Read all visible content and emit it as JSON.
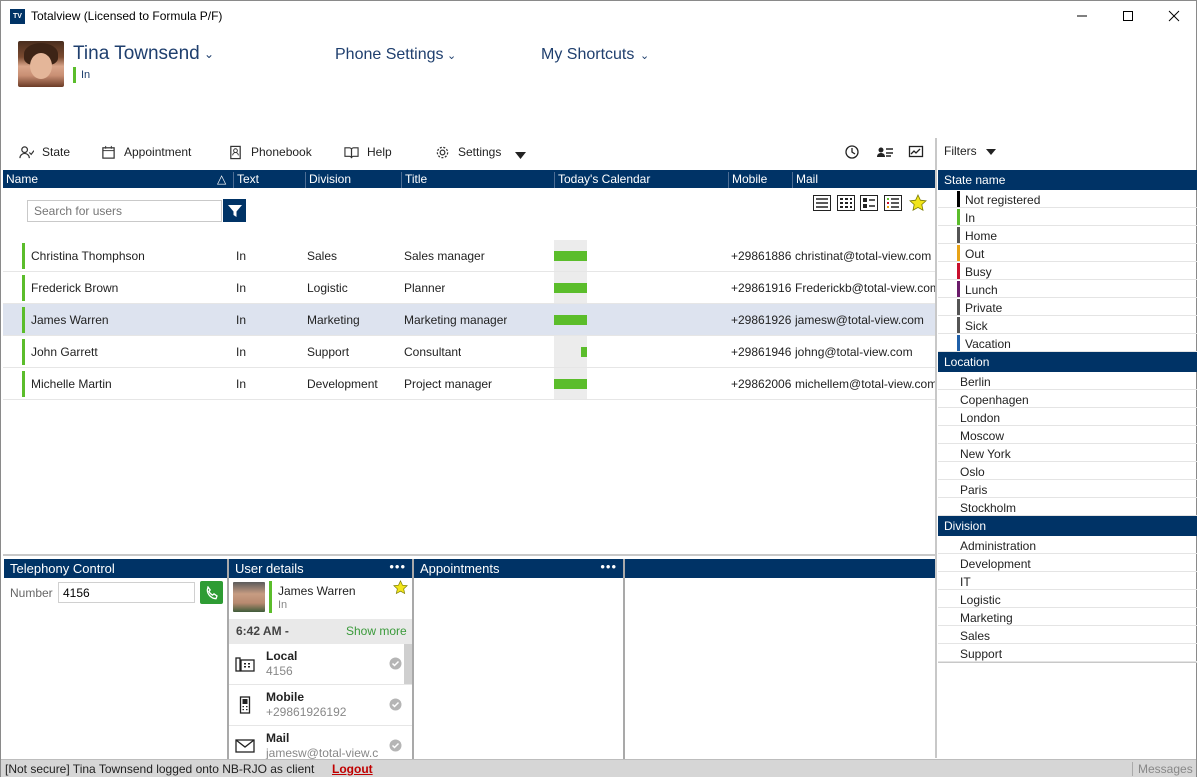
{
  "window": {
    "logo_text": "TV",
    "title": "Totalview  (Licensed to Formula P/F)"
  },
  "user": {
    "name": "Tina Townsend",
    "state": "In",
    "state_color": "#5bbd2b"
  },
  "top_menus": {
    "phone_settings": "Phone Settings",
    "my_shortcuts": "My Shortcuts"
  },
  "toolbar": {
    "state": "State",
    "appointment": "Appointment",
    "phonebook": "Phonebook",
    "help": "Help",
    "settings": "Settings"
  },
  "grid": {
    "columns": [
      "Name",
      "Text",
      "Division",
      "Title",
      "Today's Calendar",
      "Mobile",
      "Mail"
    ],
    "search_placeholder": "Search for users",
    "rows": [
      {
        "name": "Christina Thomphson",
        "text": "In",
        "division": "Sales",
        "title": "Sales manager",
        "calendar_fill": 1.0,
        "mobile": "+29861886",
        "mail": "christinat@total-view.com"
      },
      {
        "name": "Frederick Brown",
        "text": "In",
        "division": "Logistic",
        "title": "Planner",
        "calendar_fill": 1.0,
        "mobile": "+29861916",
        "mail": "Frederickb@total-view.com"
      },
      {
        "name": "James Warren",
        "text": "In",
        "division": "Marketing",
        "title": "Marketing manager",
        "calendar_fill": 1.0,
        "mobile": "+29861926",
        "mail": "jamesw@total-view.com"
      },
      {
        "name": "John Garrett",
        "text": "In",
        "division": "Support",
        "title": "Consultant",
        "calendar_fill": 0.18,
        "mobile": "+29861946",
        "mail": "johng@total-view.com"
      },
      {
        "name": "Michelle Martin",
        "text": "In",
        "division": "Development",
        "title": "Project manager",
        "calendar_fill": 1.0,
        "mobile": "+29862006",
        "mail": "michellem@total-view.com"
      }
    ]
  },
  "telephony": {
    "header": "Telephony Control",
    "number_label": "Number",
    "number_value": "4156"
  },
  "user_details": {
    "header": "User details",
    "name": "James Warren",
    "state": "In",
    "time": "6:42 AM -",
    "show_more": "Show more",
    "contacts": [
      {
        "label": "Local",
        "value": "4156"
      },
      {
        "label": "Mobile",
        "value": "+29861926192"
      },
      {
        "label": "Mail",
        "value": "jamesw@total-view.c"
      }
    ]
  },
  "appointments": {
    "header": "Appointments"
  },
  "filters": {
    "label": "Filters",
    "state_header": "State name",
    "states": [
      {
        "name": "Not registered",
        "color": "#000000"
      },
      {
        "name": "In",
        "color": "#5bbd2b"
      },
      {
        "name": "Home",
        "color": "#555555"
      },
      {
        "name": "Out",
        "color": "#e8a317"
      },
      {
        "name": "Busy",
        "color": "#c8102e"
      },
      {
        "name": "Lunch",
        "color": "#6a1b6a"
      },
      {
        "name": "Private",
        "color": "#555555"
      },
      {
        "name": "Sick",
        "color": "#555555"
      },
      {
        "name": "Vacation",
        "color": "#1f5fa8"
      }
    ],
    "location_header": "Location",
    "locations": [
      "Berlin",
      "Copenhagen",
      "London",
      "Moscow",
      "New York",
      "Oslo",
      "Paris",
      "Stockholm"
    ],
    "division_header": "Division",
    "divisions": [
      "Administration",
      "Development",
      "IT",
      "Logistic",
      "Marketing",
      "Sales",
      "Support"
    ]
  },
  "status": {
    "text": "[Not secure] Tina Townsend logged onto NB-RJO as client",
    "logout": "Logout",
    "messages": "Messages"
  }
}
